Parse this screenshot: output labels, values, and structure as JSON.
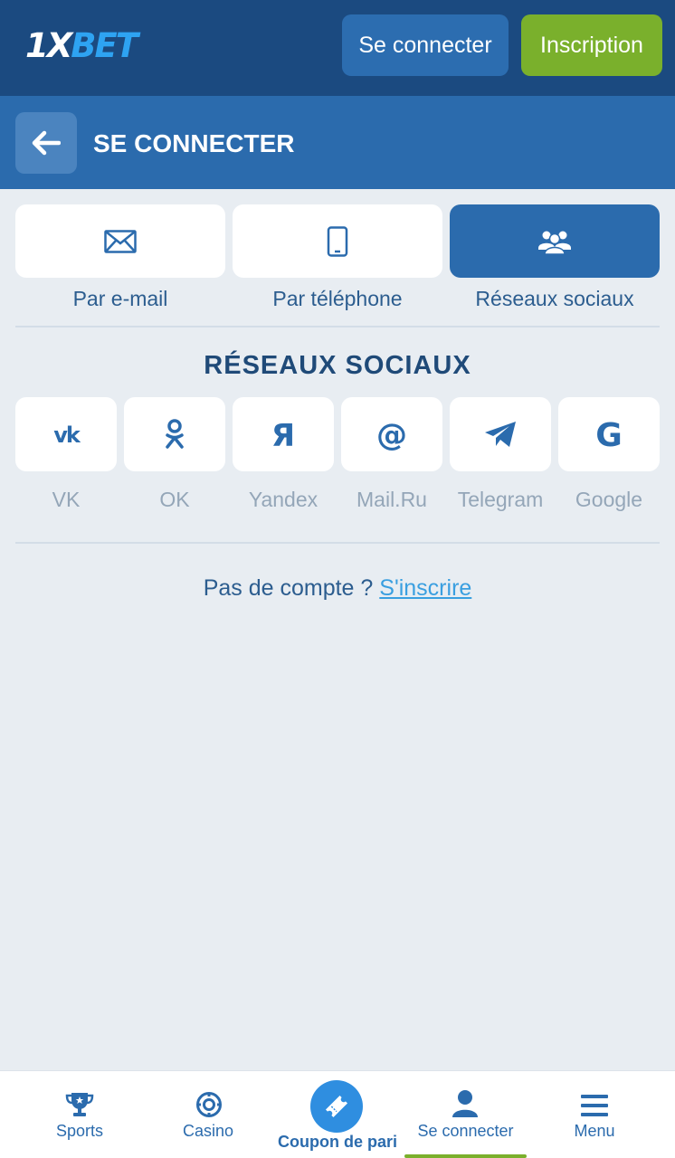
{
  "header": {
    "logo_text": "1XBET",
    "login_label": "Se connecter",
    "register_label": "Inscription"
  },
  "titlebar": {
    "back_icon": "arrow-left-icon",
    "title": "SE CONNECTER"
  },
  "login_methods": [
    {
      "label": "Par e-mail",
      "icon": "envelope-icon",
      "active": false
    },
    {
      "label": "Par téléphone",
      "icon": "phone-icon",
      "active": false
    },
    {
      "label": "Réseaux sociaux",
      "icon": "users-icon",
      "active": true
    }
  ],
  "social": {
    "title": "RÉSEAUX SOCIAUX",
    "providers": [
      {
        "label": "VK",
        "icon": "vk-icon"
      },
      {
        "label": "OK",
        "icon": "ok-icon"
      },
      {
        "label": "Yandex",
        "icon": "yandex-icon"
      },
      {
        "label": "Mail.Ru",
        "icon": "at-icon"
      },
      {
        "label": "Telegram",
        "icon": "telegram-icon"
      },
      {
        "label": "Google",
        "icon": "google-icon"
      }
    ]
  },
  "signup": {
    "prompt": "Pas de compte ?",
    "link": "S'inscrire"
  },
  "bottom_nav": {
    "items": [
      {
        "label": "Sports",
        "icon": "trophy-icon"
      },
      {
        "label": "Casino",
        "icon": "casino-chip-icon"
      },
      {
        "label": "Coupon de pari",
        "icon": "ticket-icon"
      },
      {
        "label": "Se connecter",
        "icon": "user-icon",
        "active": true
      },
      {
        "label": "Menu",
        "icon": "hamburger-icon"
      }
    ]
  },
  "colors": {
    "header_bg": "#1b4a80",
    "titlebar_bg": "#2b6bad",
    "page_bg": "#e8edf2",
    "register_green": "#7ab02c",
    "link_blue": "#3a9fe0",
    "coupon_blue": "#2f8ee0"
  }
}
